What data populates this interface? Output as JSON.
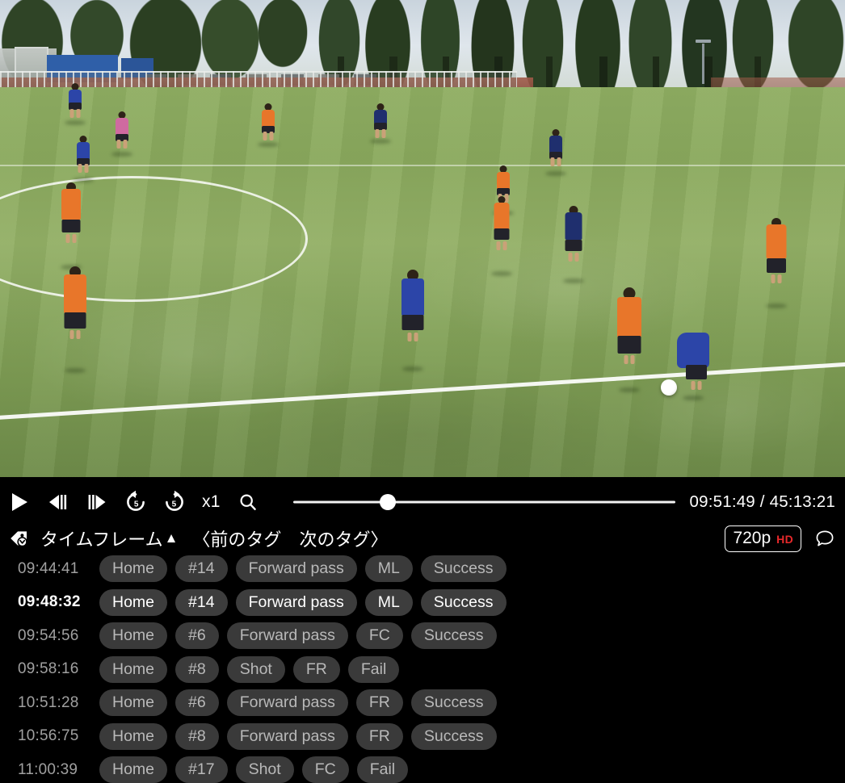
{
  "player": {
    "controls": {
      "play_label": "Play",
      "step_back_label": "Step back one frame",
      "step_forward_label": "Step forward one frame",
      "rewind_label": "5",
      "forward_label": "5",
      "speed_label": "x1",
      "search_label": "Search"
    },
    "seek": {
      "position_percent": 24.7
    },
    "time": {
      "current": "09:51:49",
      "total": "45:13:21",
      "readout": "09:51:49 / 45:13:21"
    },
    "quality": {
      "resolution": "720p",
      "badge": "HD"
    },
    "comment_label": "Comments"
  },
  "tagbar": {
    "tag_icon_label": "tag",
    "timeframe_label": "タイムフレーム",
    "timeframe_caret": "▲",
    "prev_tag_label": "〈前のタグ",
    "next_tag_label": "次のタグ〉"
  },
  "taglist": {
    "rows": [
      {
        "time": "09:44:41",
        "selected": false,
        "pills": [
          "Home",
          "#14",
          "Forward pass",
          "ML",
          "Success"
        ]
      },
      {
        "time": "09:48:32",
        "selected": true,
        "pills": [
          "Home",
          "#14",
          "Forward pass",
          "ML",
          "Success"
        ]
      },
      {
        "time": "09:54:56",
        "selected": false,
        "pills": [
          "Home",
          "#6",
          "Forward pass",
          "FC",
          "Success"
        ]
      },
      {
        "time": "09:58:16",
        "selected": false,
        "pills": [
          "Home",
          "#8",
          "Shot",
          "FR",
          "Fail"
        ]
      },
      {
        "time": "10:51:28",
        "selected": false,
        "pills": [
          "Home",
          "#6",
          "Forward pass",
          "FR",
          "Success"
        ]
      },
      {
        "time": "10:56:75",
        "selected": false,
        "pills": [
          "Home",
          "#8",
          "Forward pass",
          "FR",
          "Success"
        ]
      },
      {
        "time": "11:00:39",
        "selected": false,
        "pills": [
          "Home",
          "#17",
          "Shot",
          "FC",
          "Fail"
        ]
      }
    ]
  },
  "colors": {
    "accent_hd": "#e8292b",
    "pill_bg": "#3a3a3a",
    "pill_text": "#b9b9b9",
    "selected_text": "#ffffff",
    "background": "#000000"
  },
  "video": {
    "scene": "soccer-match-broadcast-frame",
    "team_home_color": "#e8762a",
    "team_away_color": "#2c45a8",
    "pitch_color": "#8fae62"
  }
}
